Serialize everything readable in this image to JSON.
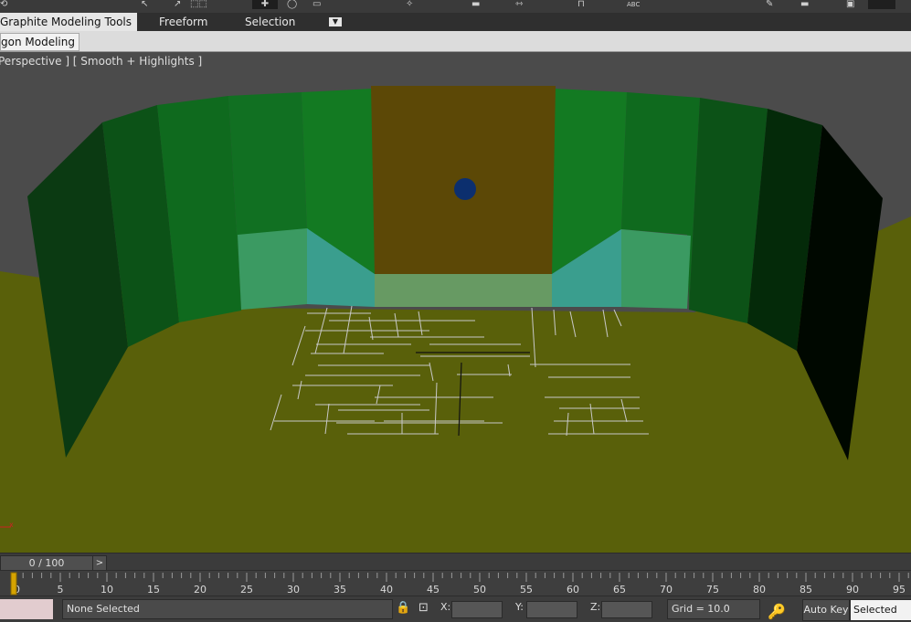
{
  "ribbon": {
    "tabs": [
      {
        "label": "Graphite Modeling Tools",
        "active": true
      },
      {
        "label": "Freeform",
        "active": false
      },
      {
        "label": "Selection",
        "active": false
      }
    ],
    "subtab_label": "gon Modeling"
  },
  "viewport": {
    "label": "Perspective ] [ Smooth + Highlights ]"
  },
  "timeline": {
    "frame_display": "0 / 100",
    "next_symbol": ">",
    "ticks": [
      "0",
      "5",
      "10",
      "15",
      "20",
      "25",
      "30",
      "35",
      "40",
      "45",
      "50",
      "55",
      "60",
      "65",
      "70",
      "75",
      "80",
      "85",
      "90",
      "95"
    ]
  },
  "status": {
    "selection": "None Selected",
    "x_label": "X:",
    "y_label": "Y:",
    "z_label": "Z:",
    "grid": "Grid = 10.0",
    "auto_key": "Auto Key",
    "set_key_mode": "Selected"
  },
  "toolbar": {
    "abc_text": "ABC"
  }
}
